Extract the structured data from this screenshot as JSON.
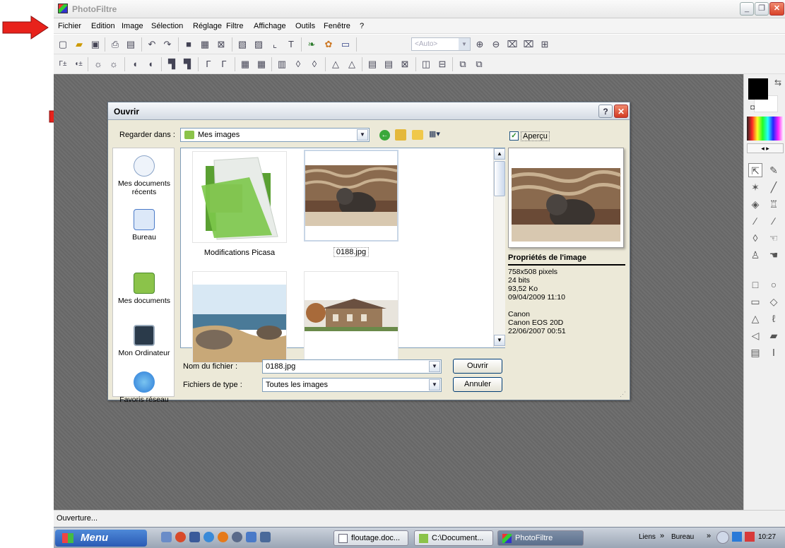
{
  "window": {
    "title": "PhotoFiltre"
  },
  "menu": [
    "Fichier",
    "Edition",
    "Image",
    "Sélection",
    "Réglage",
    "Filtre",
    "Affichage",
    "Outils",
    "Fenêtre",
    "?"
  ],
  "toolbar": {
    "zoom_value": "<Auto>"
  },
  "dialog": {
    "title": "Ouvrir",
    "look_in_label": "Regarder dans :",
    "look_in_value": "Mes images",
    "preview_checkbox": "Aperçu",
    "places": [
      "Mes documents récents",
      "Bureau",
      "Mes documents",
      "Mon Ordinateur",
      "Favoris réseau"
    ],
    "files": [
      {
        "name": "Modifications Picasa"
      },
      {
        "name": "0188.jpg"
      },
      {
        "name": ""
      },
      {
        "name": ""
      }
    ],
    "file_name_label": "Nom du fichier :",
    "file_name_value": "0188.jpg",
    "file_type_label": "Fichiers de type :",
    "file_type_value": "Toutes les images",
    "open_button": "Ouvrir",
    "cancel_button": "Annuler",
    "properties": {
      "heading": "Propriétés de l'image",
      "dimensions": "758x508 pixels",
      "bits": "24 bits",
      "size": "93,52 Ko",
      "modified": "09/04/2009 11:10",
      "make": "Canon",
      "model": "Canon EOS 20D",
      "taken": "22/06/2007 00:51"
    }
  },
  "status": {
    "text": "Ouverture..."
  },
  "taskbar": {
    "start_label": "Menu",
    "tasks": [
      "floutage.doc...",
      "C:\\Document...",
      "PhotoFiltre"
    ],
    "links_label": "Liens",
    "desktop_label": "Bureau",
    "clock": "10:27"
  },
  "colors": {
    "arrow": "#e8221b",
    "workspace": "#6b6b6b",
    "dialog_bg": "#ece9d8"
  }
}
